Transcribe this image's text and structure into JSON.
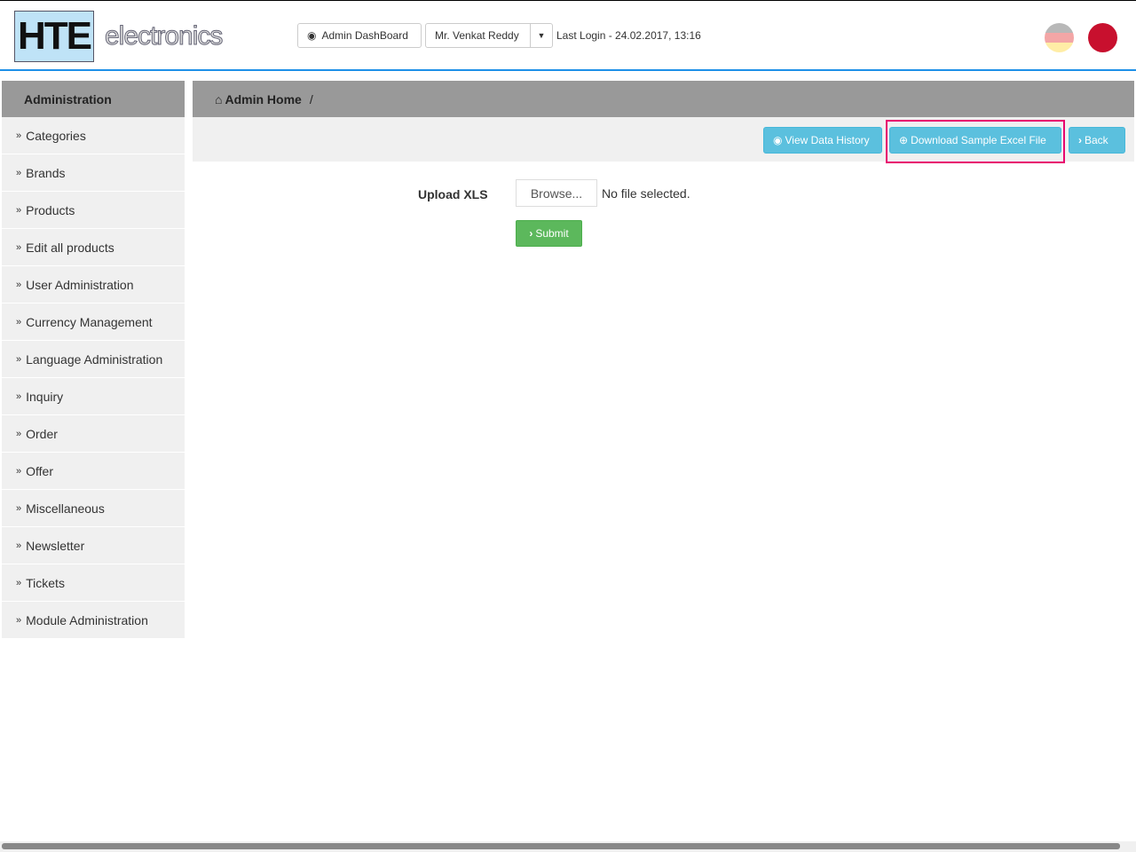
{
  "header": {
    "logo_letters": "HTE",
    "logo_text": "electronics",
    "dashboard": "Admin DashBoard",
    "user": "Mr. Venkat Reddy",
    "last_login": "Last Login - 24.02.2017, 13:16"
  },
  "sidebar": {
    "title": "Administration",
    "items": [
      "Categories",
      "Brands",
      "Products",
      "Edit all products",
      "User Administration",
      "Currency Management",
      "Language Administration",
      "Inquiry",
      "Order",
      "Offer",
      "Miscellaneous",
      "Newsletter",
      "Tickets",
      "Module Administration"
    ]
  },
  "breadcrumb": {
    "home": "Admin Home",
    "sep": "/"
  },
  "toolbar": {
    "view_history": "View Data History",
    "download": "Download Sample Excel File",
    "back": "Back"
  },
  "form": {
    "label": "Upload XLS",
    "browse": "Browse...",
    "no_file": "No file selected.",
    "submit": "Submit"
  },
  "colors": {
    "accent": "#5bc0de",
    "submit": "#5cb85c",
    "highlight": "#e8006e"
  }
}
